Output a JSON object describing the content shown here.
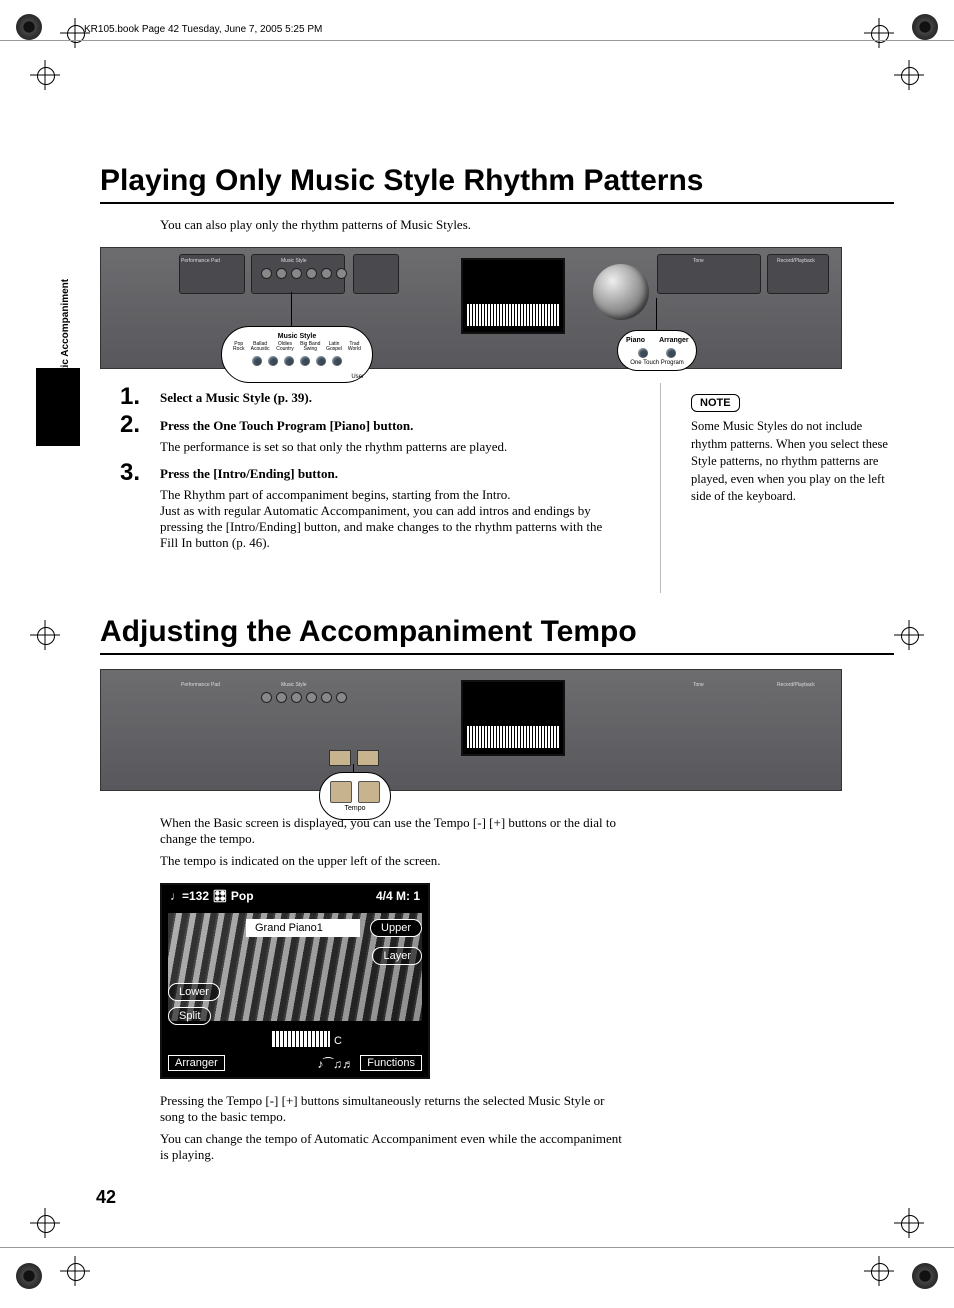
{
  "meta": {
    "header": "KR105.book  Page 42  Tuesday, June 7, 2005  5:25 PM",
    "side_label": "Automatic Accompaniment",
    "page_number": "42"
  },
  "section1": {
    "title": "Playing Only Music Style Rhythm Patterns",
    "intro": "You can also play only the rhythm patterns of Music Styles.",
    "steps": [
      {
        "num": "1.",
        "head": "Select a Music Style (p. 39).",
        "body": ""
      },
      {
        "num": "2.",
        "head": "Press the One Touch Program [Piano] button.",
        "body": "The performance is set so that only the rhythm patterns are played."
      },
      {
        "num": "3.",
        "head": "Press the [Intro/Ending] button.",
        "body": "The Rhythm part of accompaniment begins, starting from the Intro.\nJust as with regular Automatic Accompaniment, you can add intros and endings by pressing the [Intro/Ending] button, and make changes to the rhythm patterns with the Fill In button (p. 46)."
      }
    ],
    "note_label": "NOTE",
    "note_text": "Some Music Styles do not include rhythm patterns. When you select these Style patterns, no rhythm patterns are played, even when you play on the left side of the keyboard.",
    "panel_callouts": {
      "music_style": {
        "title": "Music Style",
        "items": [
          "Pop\nRock",
          "Ballad\nAcoustic",
          "Oldies\nCountry",
          "Big Band\nSwing",
          "Latin\nGospel",
          "Trad\nWorld"
        ],
        "bottom": "User"
      },
      "one_touch": {
        "left": "Piano",
        "right": "Arranger",
        "caption": "One Touch Program"
      }
    }
  },
  "section2": {
    "title": "Adjusting the Accompaniment Tempo",
    "tempo_callout_label": "Tempo",
    "paras": [
      "When the Basic screen is displayed, you can use the Tempo [-] [+] buttons or the dial to change the tempo.",
      "The tempo is indicated on the upper left of the screen.",
      "Pressing the Tempo [-] [+] buttons simultaneously returns the selected Music Style or song to the basic tempo.",
      "You can change the tempo of Automatic Accompaniment even while the accompaniment is playing."
    ],
    "lcd": {
      "top_left": "♩=132 🎛 Pop",
      "top_right": "4/4  M:    1",
      "instrument": "Grand Piano1",
      "btn_upper": "Upper",
      "btn_layer": "Layer",
      "btn_lower": "Lower",
      "btn_split": "Split",
      "note_indicator": "C",
      "bottom_left": "Arranger",
      "bottom_right": "Functions"
    }
  }
}
